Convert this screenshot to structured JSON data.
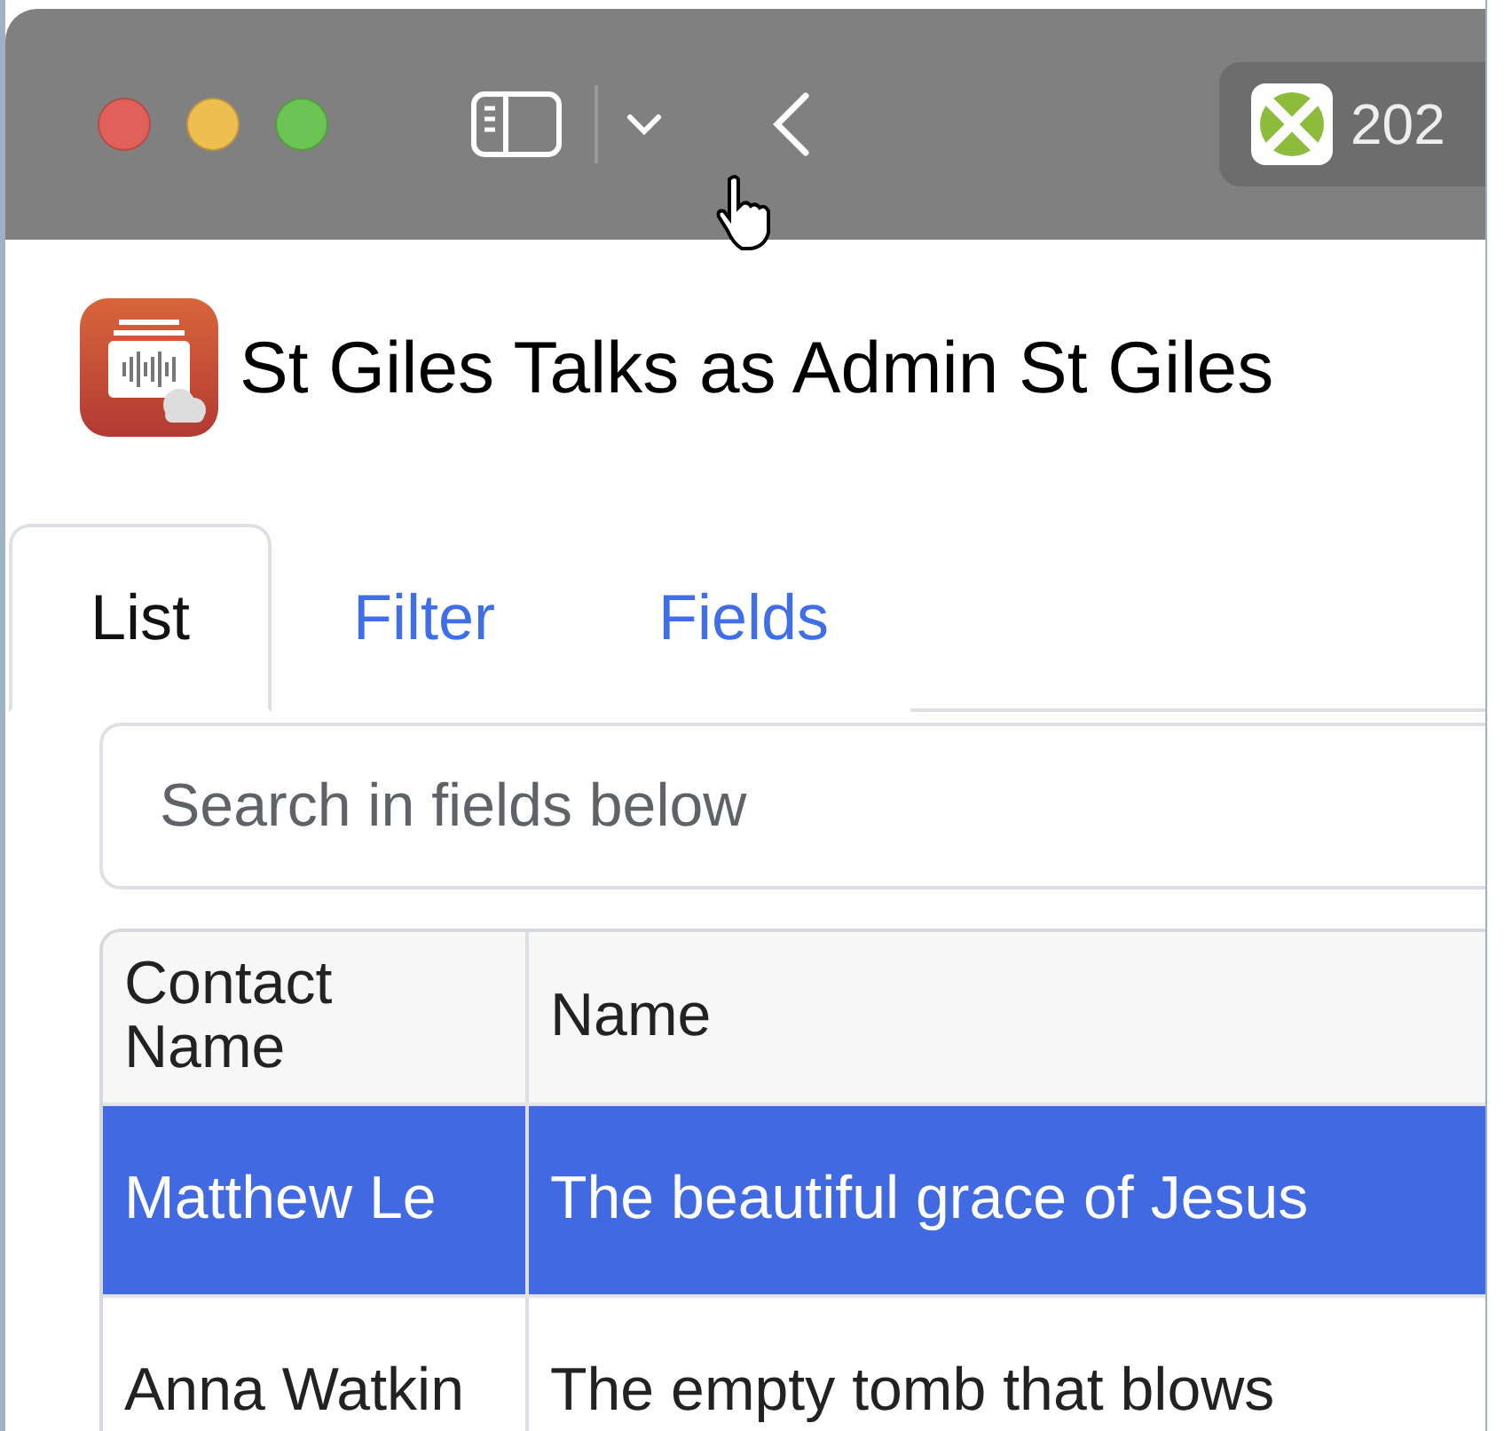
{
  "browser": {
    "tab_title": "202"
  },
  "app": {
    "title": "St Giles Talks as Admin St Giles"
  },
  "tabs": [
    {
      "label": "List",
      "selected": true
    },
    {
      "label": "Filter",
      "selected": false
    },
    {
      "label": "Fields",
      "selected": false
    }
  ],
  "search": {
    "placeholder": "Search in fields below"
  },
  "table": {
    "columns": [
      "Contact Name",
      "Name"
    ],
    "rows": [
      {
        "cells": [
          "Matthew Le",
          "The beautiful grace of Jesus"
        ],
        "selected": true
      },
      {
        "cells": [
          "Anna Watkin",
          "The empty tomb that blows"
        ],
        "selected": false
      }
    ]
  }
}
